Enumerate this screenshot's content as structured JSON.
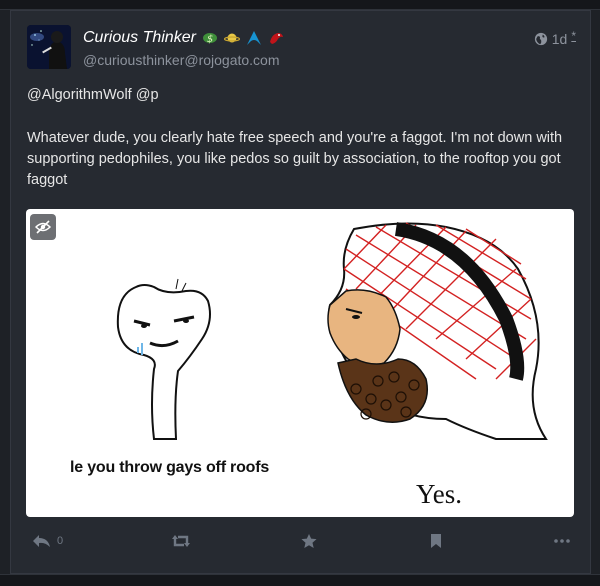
{
  "post": {
    "display_name": "Curious Thinker",
    "handle": "@curiousthinker@rojogato.com",
    "timestamp": "1d",
    "edited_marker": "*",
    "mention_line": "@AlgorithmWolf @p",
    "body": "Whatever dude, you clearly hate free speech and you're a faggot. I'm not down with supporting pedophiles, you like pedos so guilt by association, to the rooftop you got faggot",
    "name_emojis": [
      "money-emoji",
      "saturn-emoji",
      "arch-linux-emoji",
      "red-dragon-emoji"
    ]
  },
  "media": {
    "caption_left": "le you throw gays off roofs",
    "caption_right": "Yes.",
    "sensitive_toggle_icon": "eye-slash-icon"
  },
  "actions": {
    "reply_count": "0",
    "icons": [
      "reply-icon",
      "boost-icon",
      "favourite-icon",
      "bookmark-icon",
      "more-icon"
    ]
  },
  "colors": {
    "background": "#1e2126",
    "card": "#262a31",
    "muted": "#8d939d",
    "action_icon": "#6f7783"
  }
}
